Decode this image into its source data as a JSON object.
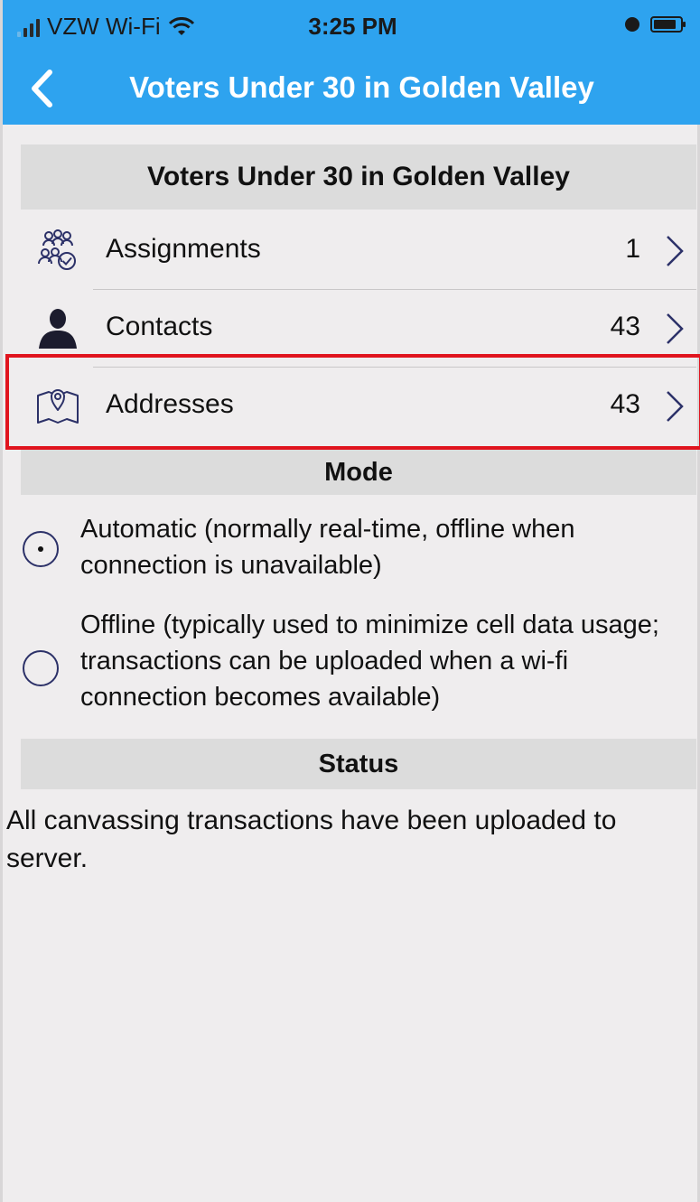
{
  "status_bar": {
    "carrier": "VZW Wi-Fi",
    "time": "3:25 PM",
    "icons": [
      "signal-icon",
      "wifi-icon",
      "alarm-icon",
      "battery-icon"
    ]
  },
  "nav": {
    "title": "Voters Under 30 in Golden Valley",
    "back_icon": "chevron-left-icon"
  },
  "main_section": {
    "header": "Voters Under 30 in Golden Valley",
    "rows": [
      {
        "label": "Assignments",
        "count": "1",
        "icon": "people-group-check-icon"
      },
      {
        "label": "Contacts",
        "count": "43",
        "icon": "person-icon"
      },
      {
        "label": "Addresses",
        "count": "43",
        "icon": "map-pin-icon"
      }
    ]
  },
  "mode_section": {
    "header": "Mode",
    "options": [
      {
        "label": "Automatic (normally real-time, offline when connection is unavailable)",
        "selected": true
      },
      {
        "label": "Offline (typically used to minimize cell data usage; transactions can be uploaded when a wi-fi connection becomes available)",
        "selected": false
      }
    ]
  },
  "status_section": {
    "header": "Status",
    "text": "All  canvassing transactions have been uploaded to server."
  },
  "colors": {
    "nav_background": "#2ea3ef",
    "page_background": "#efedee",
    "section_header_background": "#dcdcdc",
    "highlight_border": "#e0141e",
    "icon_color": "#2c3168"
  }
}
